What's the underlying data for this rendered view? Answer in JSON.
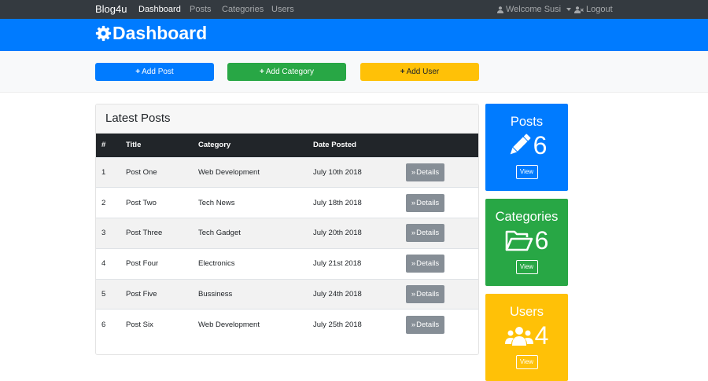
{
  "navbar": {
    "brand": "Blog4u",
    "links": [
      "Dashboard",
      "Posts",
      "Categories",
      "Users"
    ],
    "welcome": "Welcome Susi",
    "logout": "Logout"
  },
  "header": {
    "title": "Dashboard"
  },
  "actions": {
    "add_post": "Add Post",
    "add_category": "Add Category",
    "add_user": "Add User"
  },
  "posts": {
    "title": "Latest Posts",
    "columns": [
      "#",
      "Title",
      "Category",
      "Date Posted"
    ],
    "details_label": "Details",
    "rows": [
      [
        "1",
        "Post One",
        "Web Development",
        "July 10th 2018"
      ],
      [
        "2",
        "Post Two",
        "Tech News",
        "July 18th 2018"
      ],
      [
        "3",
        "Post Three",
        "Tech Gadget",
        "July 20th 2018"
      ],
      [
        "4",
        "Post Four",
        "Electronics",
        "July 21st 2018"
      ],
      [
        "5",
        "Post Five",
        "Bussiness",
        "July 24th 2018"
      ],
      [
        "6",
        "Post Six",
        "Web Development",
        "July 25th 2018"
      ]
    ]
  },
  "stats": [
    {
      "title": "Posts",
      "count": "6",
      "view": "View"
    },
    {
      "title": "Categories",
      "count": "6",
      "view": "View"
    },
    {
      "title": "Users",
      "count": "4",
      "view": "View"
    }
  ],
  "colors": {
    "primary": "#007bff",
    "success": "#28a745",
    "warning": "#ffc107",
    "dark": "#343a40"
  }
}
